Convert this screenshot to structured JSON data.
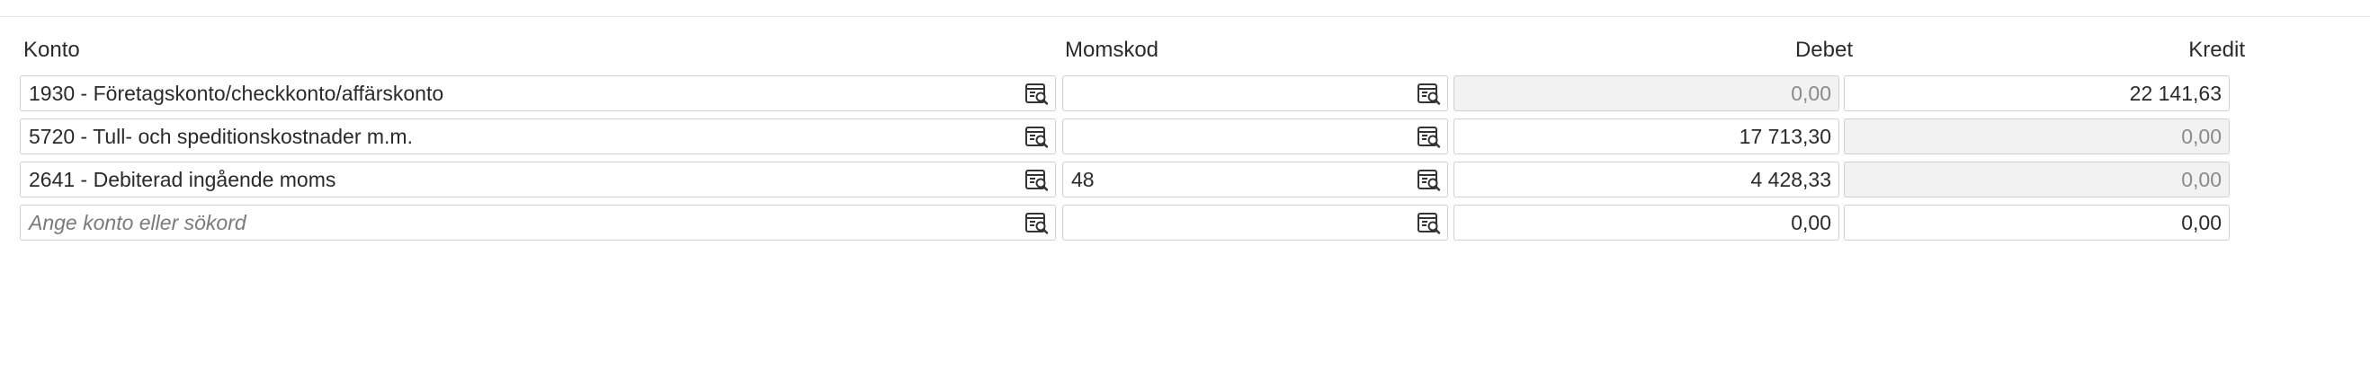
{
  "headers": {
    "konto": "Konto",
    "momskod": "Momskod",
    "debet": "Debet",
    "kredit": "Kredit"
  },
  "rows": [
    {
      "konto": "1930 - Företagskonto/checkkonto/affärskonto",
      "momskod": "",
      "debet": "0,00",
      "kredit": "22 141,63",
      "debet_disabled": true,
      "kredit_disabled": false
    },
    {
      "konto": "5720 - Tull- och speditionskostnader m.m.",
      "momskod": "",
      "debet": "17 713,30",
      "kredit": "0,00",
      "debet_disabled": false,
      "kredit_disabled": true
    },
    {
      "konto": "2641 - Debiterad ingående moms",
      "momskod": "48",
      "debet": "4 428,33",
      "kredit": "0,00",
      "debet_disabled": false,
      "kredit_disabled": true
    },
    {
      "konto": "",
      "momskod": "",
      "debet": "0,00",
      "kredit": "0,00",
      "debet_disabled": false,
      "kredit_disabled": false
    }
  ],
  "placeholders": {
    "konto": "Ange konto eller sökord"
  },
  "icons": {
    "lookup": "search-list-icon"
  },
  "colors": {
    "border": "#cfcfcf",
    "disabled_bg": "#f2f2f2",
    "disabled_text": "#8a8a8a",
    "text": "#2a2a2a"
  }
}
